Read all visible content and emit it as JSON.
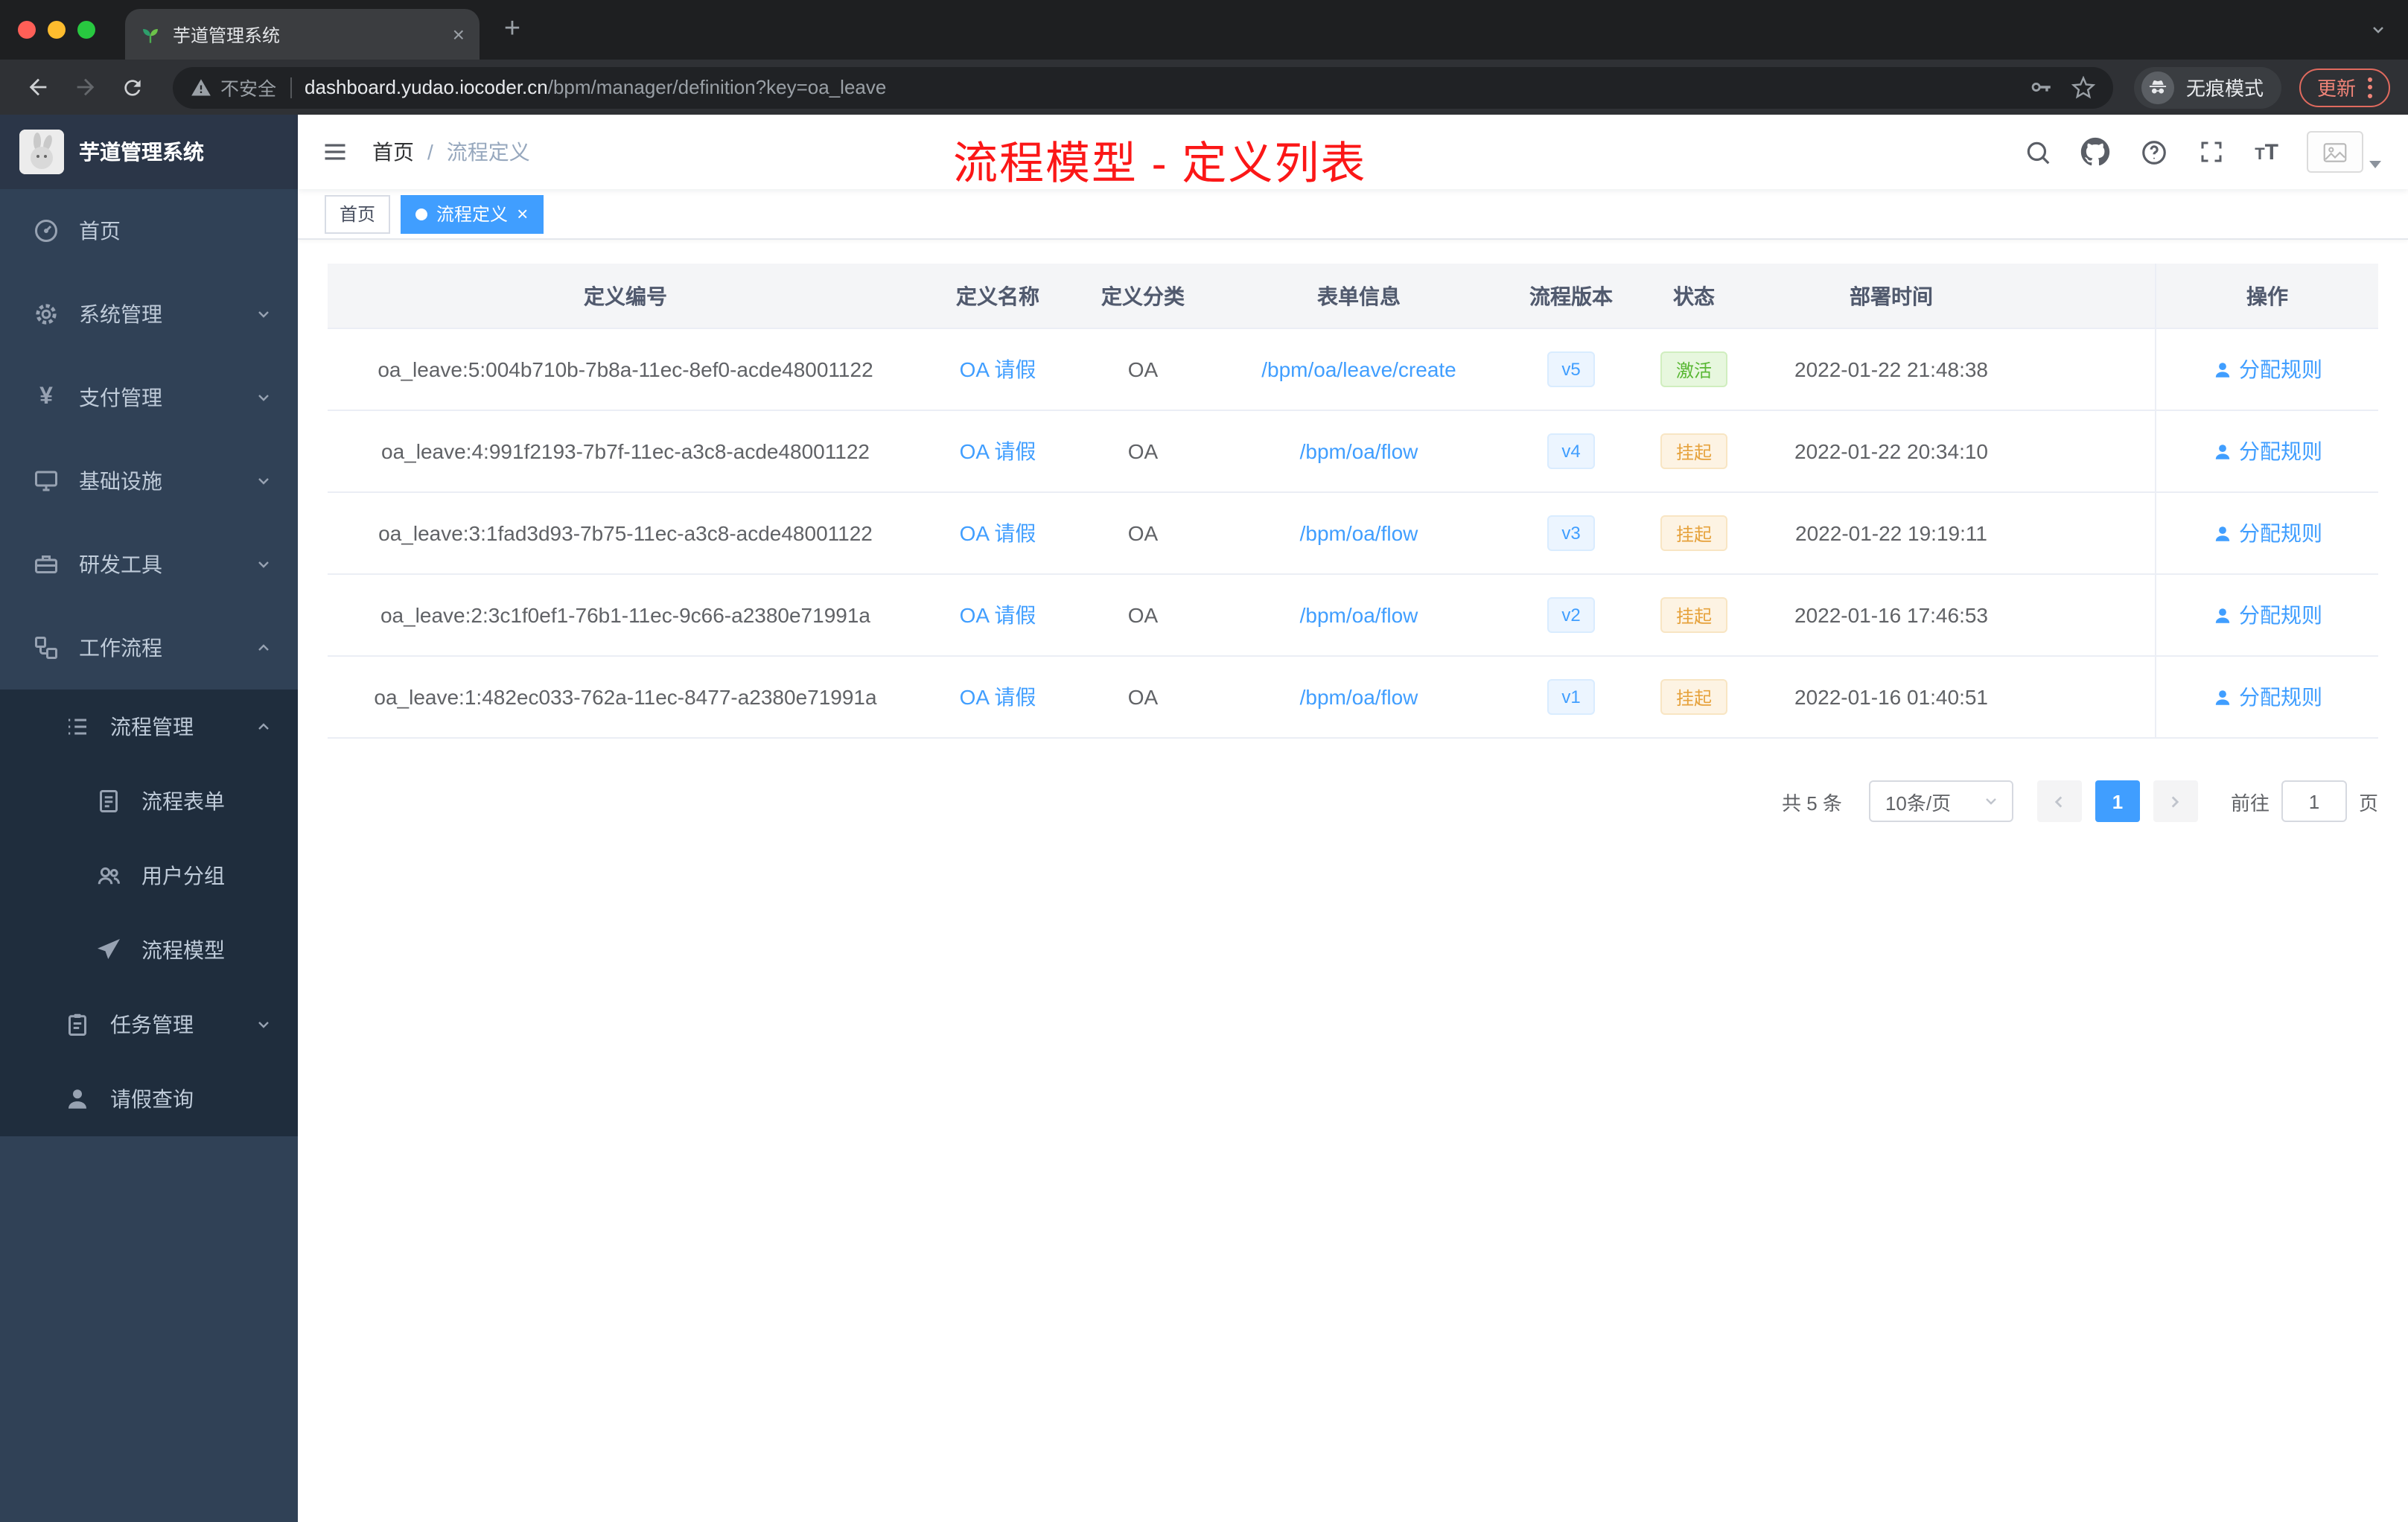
{
  "colors": {
    "accent": "#409eff",
    "success": "#58b733",
    "warning": "#e6a23c",
    "annotation_red": "#fb1717",
    "sidebar_bg": "#304156",
    "submenu_bg": "#1f2d3d"
  },
  "browser": {
    "tab_title": "芋道管理系统",
    "security_label": "不安全",
    "url_host": "dashboard.yudao.iocoder.cn",
    "url_path": "/bpm/manager/definition?key=oa_leave",
    "incognito_label": "无痕模式",
    "update_label": "更新"
  },
  "sidebar": {
    "app_title": "芋道管理系统",
    "items": [
      {
        "label": "首页",
        "icon": "dashboard-icon"
      },
      {
        "label": "系统管理",
        "icon": "gear-icon",
        "state": "collapsed"
      },
      {
        "label": "支付管理",
        "icon": "yen-icon",
        "state": "collapsed"
      },
      {
        "label": "基础设施",
        "icon": "monitor-icon",
        "state": "collapsed"
      },
      {
        "label": "研发工具",
        "icon": "toolbox-icon",
        "state": "collapsed"
      },
      {
        "label": "工作流程",
        "icon": "workflow-icon",
        "state": "expanded"
      },
      {
        "label": "流程管理",
        "icon": "list-icon",
        "state": "expanded"
      },
      {
        "label": "流程表单",
        "icon": "form-icon"
      },
      {
        "label": "用户分组",
        "icon": "user-group-icon"
      },
      {
        "label": "流程模型",
        "icon": "paper-plane-icon"
      },
      {
        "label": "任务管理",
        "icon": "clipboard-icon",
        "state": "collapsed"
      },
      {
        "label": "请假查询",
        "icon": "user-icon"
      }
    ]
  },
  "navbar": {
    "breadcrumb": {
      "home": "首页",
      "separator": "/",
      "current": "流程定义"
    },
    "annotation": "流程模型 - 定义列表",
    "icons": [
      "search-icon",
      "github-icon",
      "question-icon",
      "fullscreen-icon",
      "font-size-icon",
      "avatar"
    ]
  },
  "tags": [
    {
      "label": "首页",
      "active": false
    },
    {
      "label": "流程定义",
      "active": true
    }
  ],
  "table": {
    "columns": [
      "定义编号",
      "定义名称",
      "定义分类",
      "表单信息",
      "流程版本",
      "状态",
      "部署时间",
      "操作"
    ],
    "rows": [
      {
        "id": "oa_leave:5:004b710b-7b8a-11ec-8ef0-acde48001122",
        "name": "OA 请假",
        "category": "OA",
        "form": "/bpm/oa/leave/create",
        "version": "v5",
        "status": "激活",
        "status_type": "success",
        "time": "2022-01-22 21:48:38",
        "action": "分配规则"
      },
      {
        "id": "oa_leave:4:991f2193-7b7f-11ec-a3c8-acde48001122",
        "name": "OA 请假",
        "category": "OA",
        "form": "/bpm/oa/flow",
        "version": "v4",
        "status": "挂起",
        "status_type": "warning",
        "time": "2022-01-22 20:34:10",
        "action": "分配规则"
      },
      {
        "id": "oa_leave:3:1fad3d93-7b75-11ec-a3c8-acde48001122",
        "name": "OA 请假",
        "category": "OA",
        "form": "/bpm/oa/flow",
        "version": "v3",
        "status": "挂起",
        "status_type": "warning",
        "time": "2022-01-22 19:19:11",
        "action": "分配规则"
      },
      {
        "id": "oa_leave:2:3c1f0ef1-76b1-11ec-9c66-a2380e71991a",
        "name": "OA 请假",
        "category": "OA",
        "form": "/bpm/oa/flow",
        "version": "v2",
        "status": "挂起",
        "status_type": "warning",
        "time": "2022-01-16 17:46:53",
        "action": "分配规则"
      },
      {
        "id": "oa_leave:1:482ec033-762a-11ec-8477-a2380e71991a",
        "name": "OA 请假",
        "category": "OA",
        "form": "/bpm/oa/flow",
        "version": "v1",
        "status": "挂起",
        "status_type": "warning",
        "time": "2022-01-16 01:40:51",
        "action": "分配规则"
      }
    ]
  },
  "pagination": {
    "total": "共 5 条",
    "page_size": "10条/页",
    "current_page": "1",
    "goto_label": "前往",
    "goto_value": "1",
    "page_unit": "页"
  }
}
